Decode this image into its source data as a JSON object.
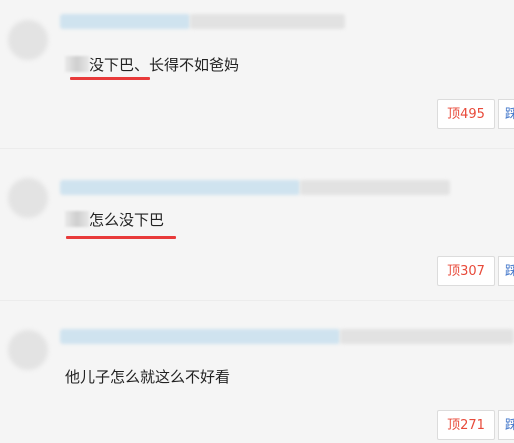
{
  "comments": [
    {
      "text_visible": "没下巴、长得不如爸妈",
      "up_label": "顶495",
      "down_label": "踩"
    },
    {
      "text_visible": "怎么没下巴",
      "up_label": "顶307",
      "down_label": "踩"
    },
    {
      "text": "他儿子怎么就这么不好看",
      "up_label": "顶271",
      "down_label": "踩"
    }
  ]
}
